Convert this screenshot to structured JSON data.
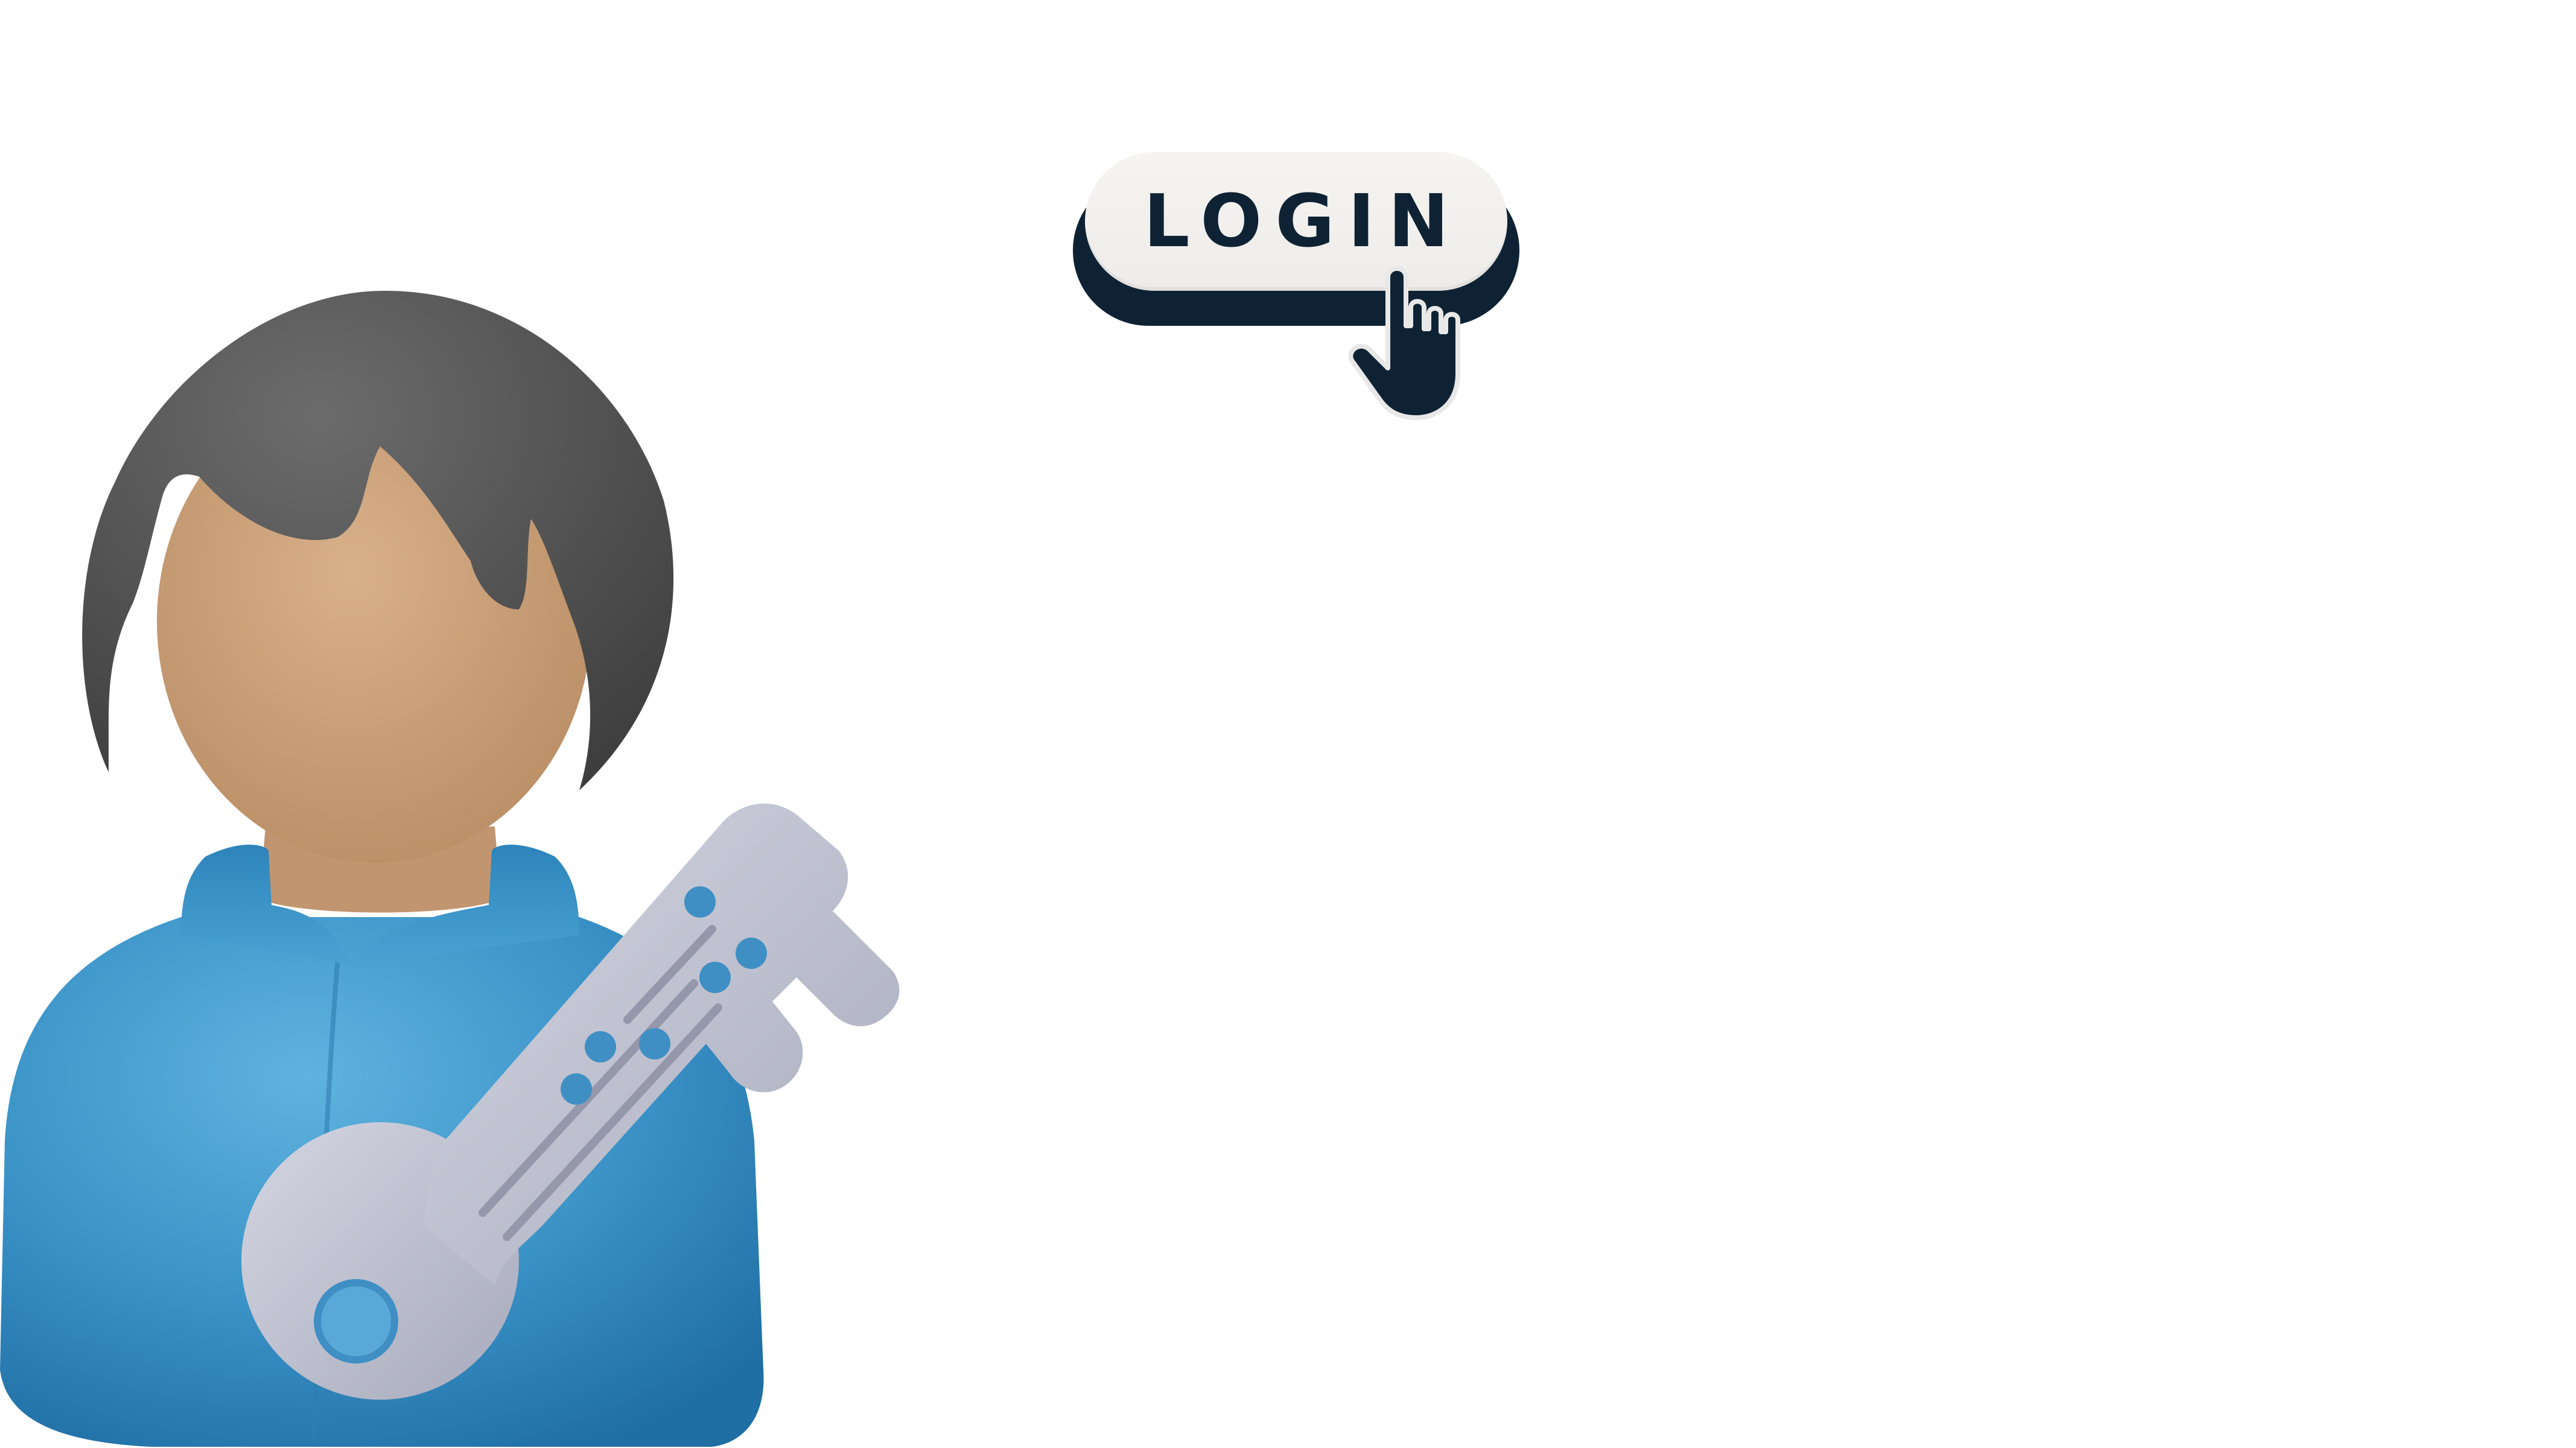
{
  "login": {
    "label": "LOGIN"
  },
  "colors": {
    "button_face": "#f2f0ed",
    "button_shadow": "#0e2233",
    "label": "#0e2233",
    "shirt": "#3f97c7",
    "skin": "#caa17a",
    "hair": "#4a4a4a",
    "key": "#b9bccb",
    "key_dots": "#3f8fc4"
  },
  "icons": {
    "user": "user-avatar-icon",
    "key": "key-icon",
    "cursor": "hand-pointer-icon"
  }
}
